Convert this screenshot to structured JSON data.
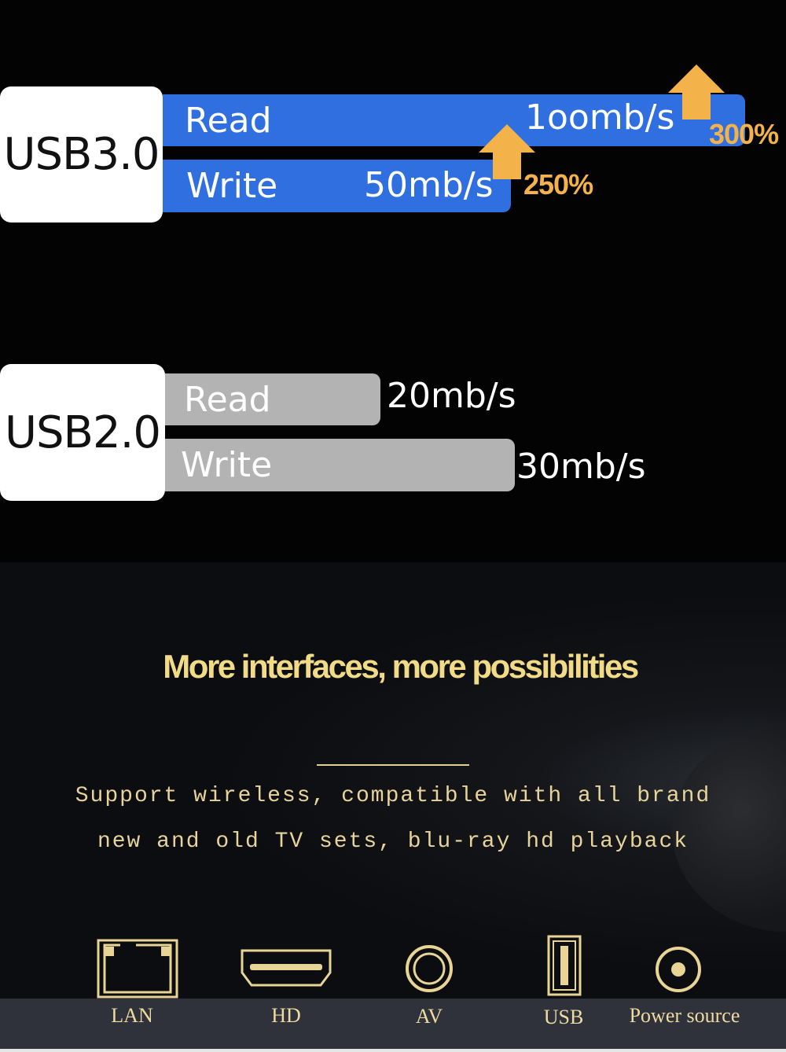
{
  "usb3": {
    "label": "USB3.0",
    "read_label": "Read",
    "read_value": "1oomb/s",
    "read_increase": "300%",
    "write_label": "Write",
    "write_value": "50mb/s",
    "write_increase": "250%"
  },
  "usb2": {
    "label": "USB2.0",
    "read_label": "Read",
    "read_value": "20mb/s",
    "write_label": "Write",
    "write_value": "30mb/s"
  },
  "headline": "More interfaces, more possibilities",
  "description": [
    "Support wireless, compatible with all brand",
    "new and old TV sets, blu-ray hd playback"
  ],
  "ports": [
    {
      "label": "LAN",
      "icon": "lan-port-icon"
    },
    {
      "label": "HD",
      "icon": "hdmi-port-icon"
    },
    {
      "label": "AV",
      "icon": "av-port-icon"
    },
    {
      "label": "USB",
      "icon": "usb-port-icon"
    },
    {
      "label": "Power source",
      "icon": "power-port-icon"
    }
  ],
  "colors": {
    "usb3_bar": "#2f6fe0",
    "usb2_bar": "#b3b3b3",
    "accent": "#f3b24a",
    "gold": "#f2db86"
  }
}
